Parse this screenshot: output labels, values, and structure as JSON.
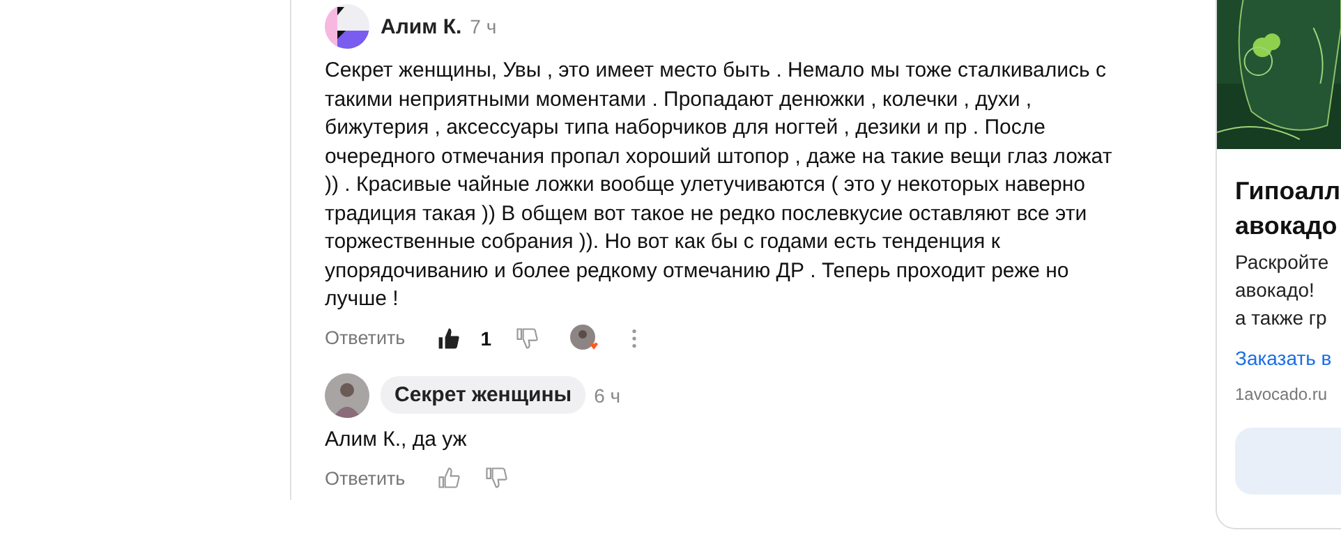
{
  "comments": [
    {
      "author": "Алим К.",
      "author_pill": false,
      "time": "7 ч",
      "text": "Секрет женщины, Увы , это имеет место быть . Немало мы тоже сталкивались с\nтакими неприятными моментами . Пропадают денюжки , колечки , духи ,\nбижутерия , аксессуары типа наборчиков для ногтей , дезики и пр . После\nочередного отмечания пропал хороший штопор , даже на такие вещи глаз ложат\n)) . Красивые чайные ложки вообще улетучиваются ( это у некоторых наверно\nтрадиция такая )) В общем вот такое не редко послевкусие оставляют все эти\nторжественные собрания )). Но вот как бы с годами есть тенденция к\nупорядочиванию и более редкому отмечанию ДР . Теперь проходит реже но\nлучше !",
      "reply_label": "Ответить",
      "liked": true,
      "likes": "1",
      "reactors": true,
      "more": true
    },
    {
      "author": "Секрет женщины",
      "author_pill": true,
      "time": "6 ч",
      "text": "Алим К., да уж",
      "reply_label": "Ответить",
      "liked": false,
      "reactors": false,
      "more": false
    }
  ],
  "ad": {
    "title": [
      "Гипоалл",
      "авокадо"
    ],
    "description": [
      "Раскройте",
      "авокадо!",
      "а также гр"
    ],
    "link": "Заказать в",
    "domain": "1avocado.ru"
  }
}
